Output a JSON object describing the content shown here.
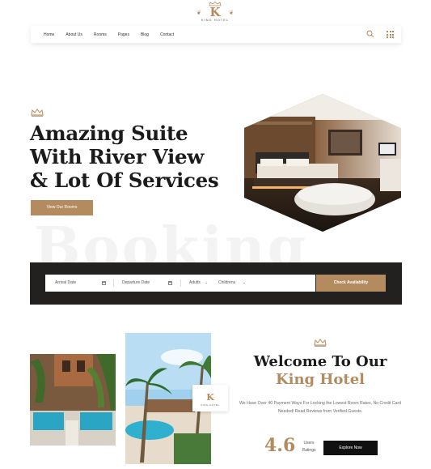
{
  "brand": {
    "letter": "K",
    "name": "KING HOTEL"
  },
  "nav": {
    "items": [
      "Home",
      "About Us",
      "Rooms",
      "Pages",
      "Blog",
      "Contact"
    ]
  },
  "icons": {
    "search": "search-icon",
    "menu": "grid-menu-icon",
    "crown": "crown-icon",
    "calendar": "calendar-icon",
    "chevron": "chevron-down-icon"
  },
  "hero": {
    "title_lines": [
      "Amazing Suite",
      "With River View",
      "& Lot Of Services"
    ],
    "cta_label": "View Our Rooms",
    "watermark": "Booking"
  },
  "booking": {
    "arrival_placeholder": "Arrival Date",
    "departure_placeholder": "Departure Date",
    "adults_label": "Adults",
    "children_label": "Childrens",
    "check_label": "Check Availability"
  },
  "welcome": {
    "title_line1": "Welcome To Our",
    "title_line2": "King Hotel",
    "description": "We Have Over 40 Payment Ways For Locking the Lowest Room Rates, No Credit Card Needed! Read Reviews from Verified Guests.",
    "rating": "4.6",
    "rating_label_1": "Users",
    "rating_label_2": "Ratings",
    "explore_label": "Explore Now",
    "badge_letter": "K",
    "badge_name": "KING HOTEL"
  },
  "colors": {
    "accent": "#b48a5f",
    "dark": "#232120",
    "text": "#1b1b1b"
  }
}
